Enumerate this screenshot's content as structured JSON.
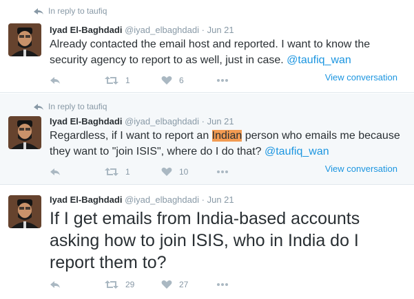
{
  "tweets": [
    {
      "reply_to": "In reply to taufiq",
      "fullname": "Iyad El-Baghdadi",
      "username": "@iyad_elbaghdadi",
      "separator": "·",
      "time": "Jun 21",
      "text_before": "Already contacted the email host and reported. I want to know the security agency to report to as well, just in case. ",
      "highlight": "",
      "text_after": "",
      "mention": "@taufiq_wan",
      "retweets": "1",
      "likes": "6",
      "view_conversation": "View conversation"
    },
    {
      "reply_to": "In reply to taufiq",
      "fullname": "Iyad El-Baghdadi",
      "username": "@iyad_elbaghdadi",
      "separator": "·",
      "time": "Jun 21",
      "text_before": "Regardless, if I want to report an ",
      "highlight": "Indian",
      "text_after": " person who emails me because they want to \"join ISIS\", where do I do that? ",
      "mention": "@taufiq_wan",
      "retweets": "1",
      "likes": "10",
      "view_conversation": "View conversation"
    },
    {
      "fullname": "Iyad El-Baghdadi",
      "username": "@iyad_elbaghdadi",
      "separator": "·",
      "time": "Jun 21",
      "text": "If I get emails from India-based accounts asking how to join ISIS, who in India do I report them to?",
      "retweets": "29",
      "likes": "27"
    }
  ],
  "icons": {
    "reply": "reply-icon",
    "retweet": "retweet-icon",
    "like": "heart-icon",
    "more": "more-icon",
    "reply_context": "reply-arrow-icon"
  },
  "colors": {
    "name": "#292f33",
    "meta": "#8899a6",
    "link": "#1b95e0",
    "highlight": "#f29b52",
    "action_icon": "#aab8c2"
  }
}
